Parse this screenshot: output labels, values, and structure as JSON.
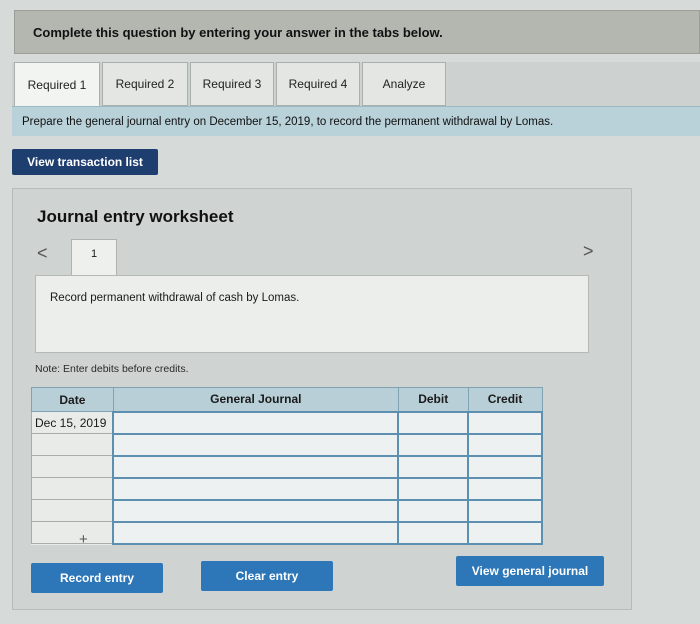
{
  "header": {
    "instruction": "Complete this question by entering your answer in the tabs below."
  },
  "tabs": [
    {
      "label": "Required 1"
    },
    {
      "label": "Required 2"
    },
    {
      "label": "Required 3"
    },
    {
      "label": "Required 4"
    },
    {
      "label": "Analyze"
    }
  ],
  "prompt": "Prepare the general journal entry on December 15, 2019, to record the permanent withdrawal by Lomas.",
  "buttons": {
    "view_transactions": "View transaction list",
    "record_entry": "Record entry",
    "clear_entry": "Clear entry",
    "view_general_journal": "View general journal"
  },
  "worksheet": {
    "title": "Journal entry worksheet",
    "prev": "<",
    "next": ">",
    "page": "1",
    "description": "Record permanent withdrawal of cash by Lomas.",
    "note": "Note: Enter debits before credits."
  },
  "journal": {
    "columns": [
      "Date",
      "General Journal",
      "Debit",
      "Credit"
    ],
    "rows": [
      {
        "date": "Dec 15, 2019",
        "account": "",
        "debit": "",
        "credit": ""
      },
      {
        "date": "",
        "account": "",
        "debit": "",
        "credit": ""
      },
      {
        "date": "",
        "account": "",
        "debit": "",
        "credit": ""
      },
      {
        "date": "",
        "account": "",
        "debit": "",
        "credit": ""
      },
      {
        "date": "",
        "account": "",
        "debit": "",
        "credit": ""
      },
      {
        "date": "",
        "account": "",
        "debit": "",
        "credit": ""
      }
    ],
    "add_row_icon": "+"
  }
}
